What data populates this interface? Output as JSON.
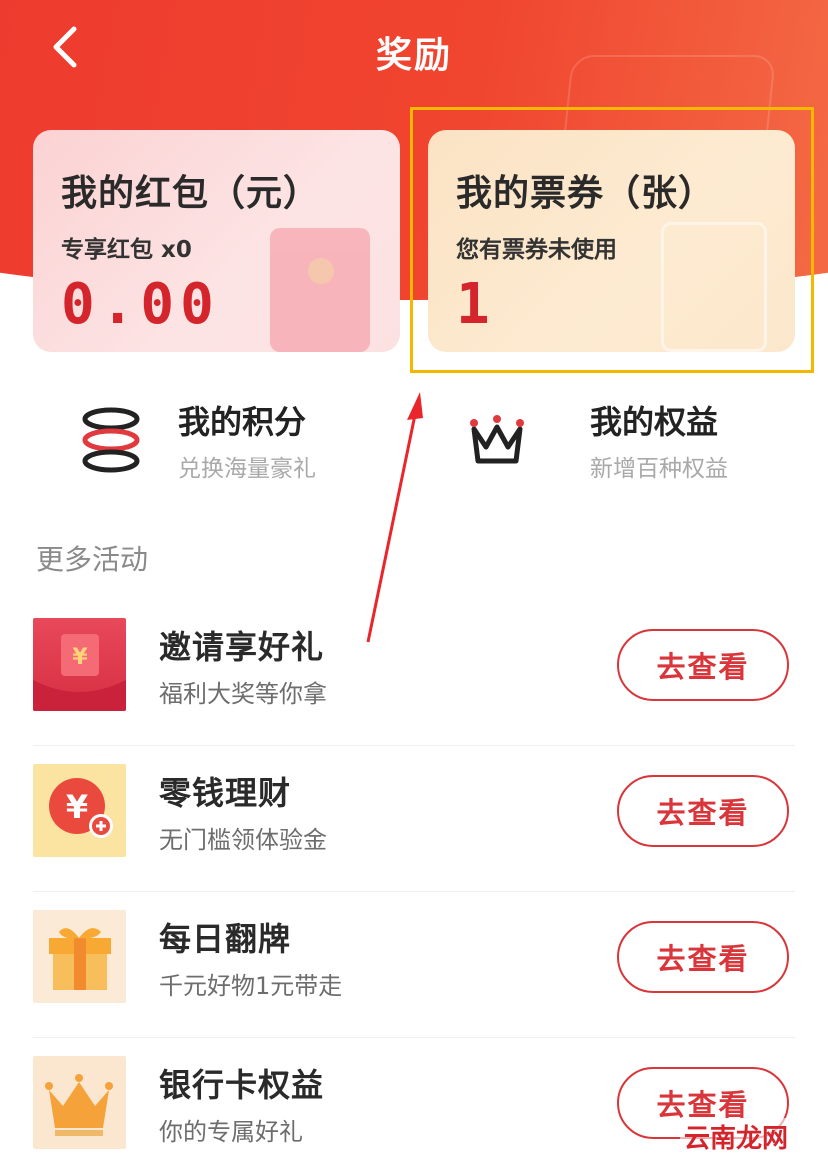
{
  "header": {
    "title": "奖励",
    "back_icon": "chevron-left-icon"
  },
  "cards": {
    "red_packet": {
      "title": "我的红包（元）",
      "subtitle": "专享红包 x0",
      "value": "0.00"
    },
    "coupon": {
      "title": "我的票券（张）",
      "subtitle": "您有票券未使用",
      "value": "1"
    }
  },
  "quick_links": {
    "points": {
      "title": "我的积分",
      "subtitle": "兑换海量豪礼",
      "icon": "coins-stack-icon"
    },
    "rights": {
      "title": "我的权益",
      "subtitle": "新增百种权益",
      "icon": "crown-icon"
    }
  },
  "more": {
    "section_title": "更多活动",
    "items": [
      {
        "title": "邀请享好礼",
        "subtitle": "福利大奖等你拿",
        "button": "去查看",
        "icon": "red-envelope-icon"
      },
      {
        "title": "零钱理财",
        "subtitle": "无门槛领体验金",
        "button": "去查看",
        "icon": "yuan-coin-icon"
      },
      {
        "title": "每日翻牌",
        "subtitle": "千元好物1元带走",
        "button": "去查看",
        "icon": "gift-box-icon"
      },
      {
        "title": "银行卡权益",
        "subtitle": "你的专属好礼",
        "button": "去查看",
        "icon": "crown-icon"
      }
    ]
  },
  "watermark": "云南龙网",
  "colors": {
    "brand_red": "#ee3b2f",
    "value_red": "#d4252c",
    "highlight": "#f5b800"
  }
}
